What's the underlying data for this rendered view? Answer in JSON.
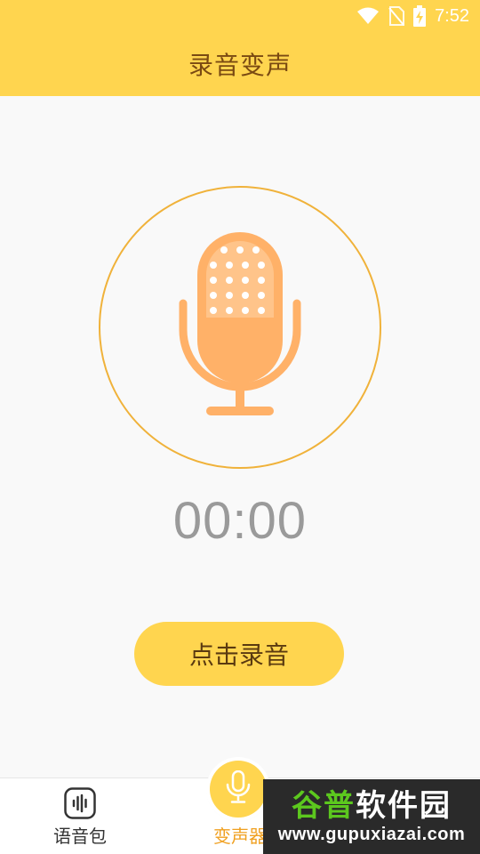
{
  "status_bar": {
    "time": "7:52",
    "icons": [
      "wifi-icon",
      "no-sim-icon",
      "battery-charging-icon"
    ]
  },
  "header": {
    "title": "录音变声"
  },
  "main": {
    "mic_icon": "microphone-icon",
    "timer": "00:00",
    "record_button_label": "点击录音"
  },
  "bottom_nav": {
    "items": [
      {
        "label": "语音包",
        "icon": "voice-pack-icon",
        "active": false
      },
      {
        "label": "变声器",
        "icon": "microphone-icon",
        "active": true
      }
    ]
  },
  "watermark": {
    "brand_prefix": "谷普",
    "brand_suffix": "软件园",
    "url": "www.gupuxiazai.com"
  },
  "colors": {
    "accent": "#ffd54f",
    "mic": "#ffb168",
    "circle_border": "#f0b23a",
    "timer": "#9a9a9a",
    "nav_active": "#f0a020"
  }
}
